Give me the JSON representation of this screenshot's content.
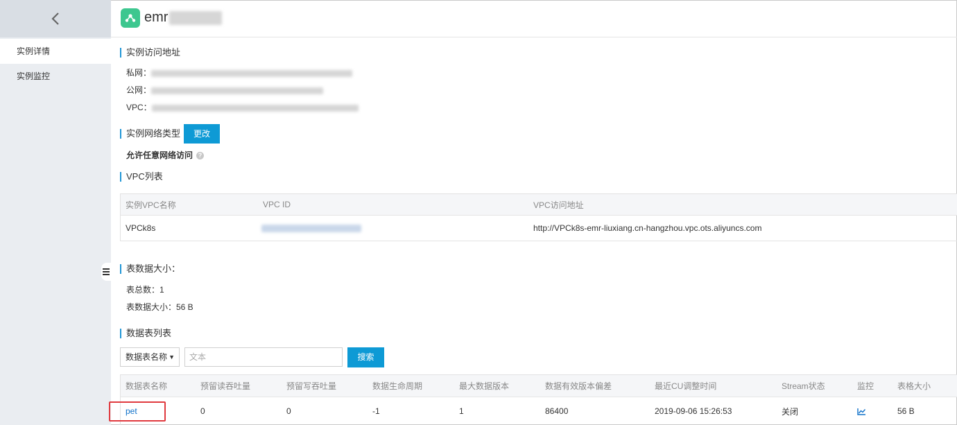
{
  "sidebar": {
    "items": [
      {
        "label": "实例详情",
        "active": true
      },
      {
        "label": "实例监控",
        "active": false
      }
    ]
  },
  "header": {
    "title": "emr"
  },
  "access": {
    "section_title": "实例访问地址",
    "private_label": "私网：",
    "public_label": "公网：",
    "vpc_label": "VPC："
  },
  "network": {
    "section_title": "实例网络类型",
    "change_button": "更改",
    "allow_text": "允许任意网络访问"
  },
  "vpc_list": {
    "section_title": "VPC列表",
    "columns": [
      "实例VPC名称",
      "VPC ID",
      "VPC访问地址"
    ],
    "rows": [
      {
        "name": "VPCk8s",
        "vpc_id": "",
        "address": "http://VPCk8s-emr-liuxiang.cn-hangzhou.vpc.ots.aliyuncs.com"
      }
    ]
  },
  "table_size": {
    "section_title": "表数据大小：",
    "total_label": "表总数：1",
    "size_label": "表数据大小：56 B"
  },
  "data_tables": {
    "section_title": "数据表列表",
    "filter_select": "数据表名称",
    "search_placeholder": "文本",
    "search_button": "搜索",
    "columns": [
      "数据表名称",
      "预留读吞吐量",
      "预留写吞吐量",
      "数据生命周期",
      "最大数据版本",
      "数据有效版本偏差",
      "最近CU调整时间",
      "Stream状态",
      "监控",
      "表格大小"
    ],
    "rows": [
      {
        "name": "pet",
        "read": "0",
        "write": "0",
        "ttl": "-1",
        "max_versions": "1",
        "deviation": "86400",
        "cu_time": "2019-09-06 15:26:53",
        "stream": "关闭",
        "monitor_icon": "line-chart-icon",
        "size": "56 B"
      }
    ]
  },
  "colors": {
    "accent": "#0e9ad5",
    "sidebar_bg": "#eaedf1",
    "highlight": "#e0393e",
    "logo": "#3dc78f"
  }
}
